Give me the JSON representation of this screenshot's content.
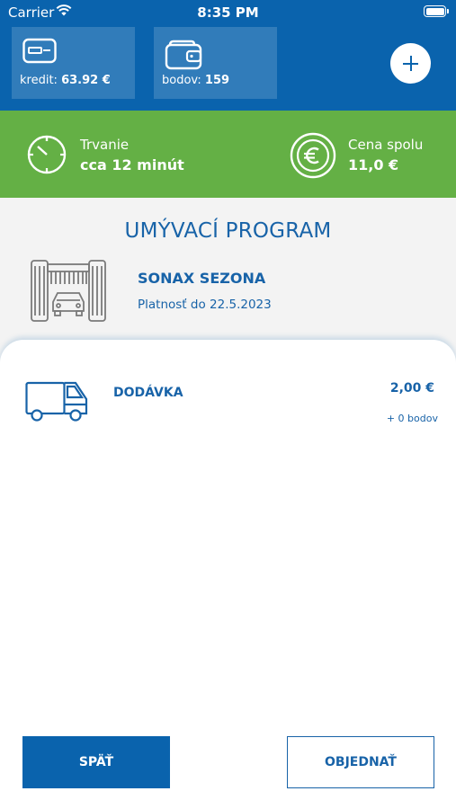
{
  "status_bar": {
    "carrier": "Carrier",
    "time": "8:35 PM"
  },
  "header": {
    "credit": {
      "label": "kredit:",
      "value": "63.92 €",
      "icon": "credit-card-icon"
    },
    "points": {
      "label": "bodov:",
      "value": "159",
      "icon": "wallet-icon"
    },
    "add_icon": "plus-icon"
  },
  "info": {
    "duration": {
      "label": "Trvanie",
      "value": "cca 12 minút",
      "icon": "stopwatch-icon"
    },
    "price": {
      "label": "Cena spolu",
      "value": "11,0 €",
      "icon": "euro-coin-icon"
    }
  },
  "program": {
    "heading": "UMÝVACÍ PROGRAM",
    "name": "SONAX SEZONA",
    "validity": "Platnosť do 22.5.2023",
    "icon": "car-wash-icon"
  },
  "items": [
    {
      "name": "DODÁVKA",
      "price": "2,00 €",
      "points": "+ 0 bodov",
      "icon": "van-icon"
    }
  ],
  "buttons": {
    "back": "SPÄŤ",
    "order": "OBJEDNAŤ"
  },
  "colors": {
    "header": "#0a63ad",
    "band": "#64b045",
    "text": "#1863a8",
    "section": "#f3f3f3"
  }
}
